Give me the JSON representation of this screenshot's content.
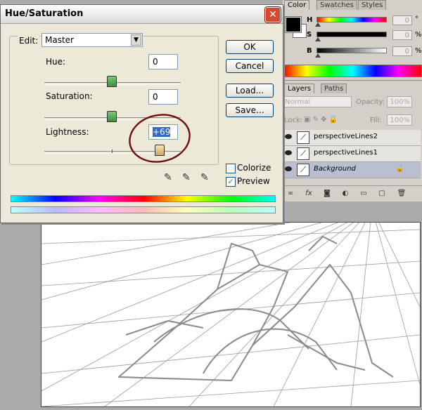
{
  "dialog": {
    "title": "Hue/Saturation",
    "edit_label": "Edit:",
    "edit_value": "Master",
    "hue_label": "Hue:",
    "hue_value": "0",
    "saturation_label": "Saturation:",
    "saturation_value": "0",
    "lightness_label": "Lightness:",
    "lightness_value": "+69",
    "ok_label": "OK",
    "cancel_label": "Cancel",
    "load_label": "Load...",
    "save_label": "Save...",
    "colorize_label": "Colorize",
    "colorize_checked": false,
    "preview_label": "Preview",
    "preview_checked": true,
    "close_glyph": "✕"
  },
  "color_panel": {
    "tabs": [
      "Color",
      "Swatches",
      "Styles"
    ],
    "h_label": "H",
    "s_label": "S",
    "b_label": "B",
    "h_value": "0",
    "s_value": "0",
    "b_value": "0",
    "h_unit": "°",
    "s_unit": "%",
    "b_unit": "%"
  },
  "layers_panel": {
    "tabs": [
      "Layers",
      "Paths"
    ],
    "blend_mode": "Normal",
    "opacity_label": "Opacity:",
    "opacity_value": "100%",
    "lock_label": "Lock:",
    "fill_label": "Fill:",
    "fill_value": "100%",
    "layers": [
      "perspectiveLines2",
      "perspectiveLines1",
      "Background"
    ]
  },
  "colors": {
    "annotation_circle": "#6e0f0f",
    "dialog_bg": "#ece9d8",
    "selected_layer": "#b9bfd0"
  }
}
